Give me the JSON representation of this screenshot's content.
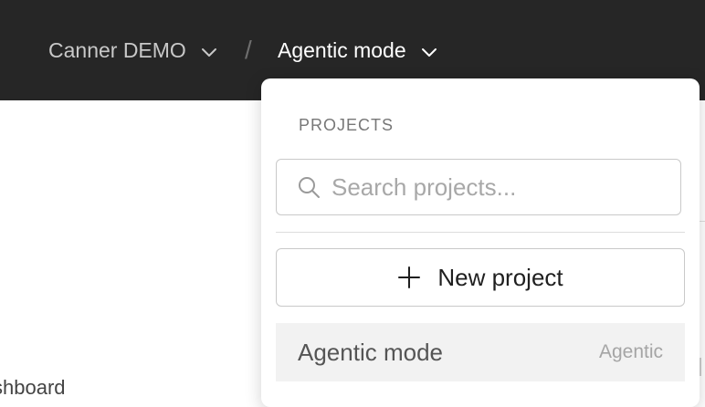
{
  "header": {
    "org_name": "Canner DEMO",
    "separator": "/",
    "project_name": "Agentic mode"
  },
  "background": {
    "partial_text": "shboard"
  },
  "dropdown": {
    "section_label": "PROJECTS",
    "search_placeholder": "Search projects...",
    "search_value": "",
    "new_project_label": "New project",
    "projects": [
      {
        "name": "Agentic mode",
        "mode": "Agentic"
      }
    ]
  },
  "colors": {
    "topbar": "#262626",
    "hover_row": "#f2f2f2",
    "border": "#c9c9c9"
  },
  "icons": [
    "chevron-down-icon",
    "search-icon",
    "plus-icon"
  ]
}
